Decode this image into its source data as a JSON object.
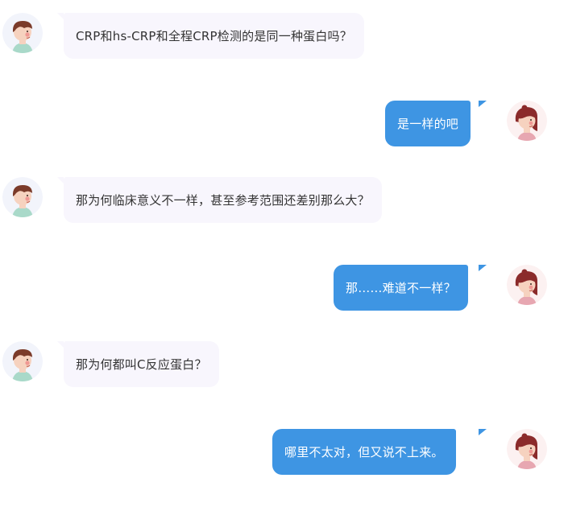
{
  "conversation": {
    "messages": [
      {
        "sender": "boy",
        "text": "CRP和hs-CRP和全程CRP检测的是同一种蛋白吗？"
      },
      {
        "sender": "girl",
        "text": "是一样的吧"
      },
      {
        "sender": "boy",
        "text": "那为何临床意义不一样，甚至参考范围还差别那么大？"
      },
      {
        "sender": "girl",
        "text": "那……难道不一样？"
      },
      {
        "sender": "boy",
        "text": "那为何都叫C反应蛋白？"
      },
      {
        "sender": "girl",
        "text": "哪里不太对，但又说不上来。"
      }
    ]
  },
  "colors": {
    "incoming_bubble": "#f8f6fd",
    "outgoing_bubble": "#3e95e3",
    "incoming_text": "#333333",
    "outgoing_text": "#ffffff"
  },
  "icons": {
    "boy_avatar": "boy-avatar-icon",
    "girl_avatar": "girl-avatar-icon"
  }
}
